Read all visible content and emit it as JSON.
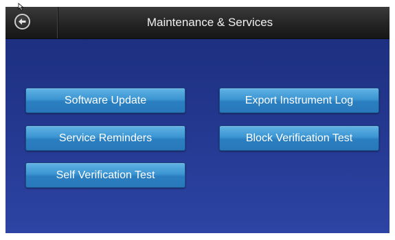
{
  "header": {
    "title": "Maintenance & Services",
    "back_icon": "back-arrow-icon"
  },
  "buttons": {
    "software_update": "Software Update",
    "service_reminders": "Service Reminders",
    "self_verification_test": "Self Verification Test",
    "export_instrument_log": "Export Instrument Log",
    "block_verification_test": "Block Verification Test"
  },
  "colors": {
    "background": "#22368c",
    "titlebar": "#242424",
    "button": "#3c95d2"
  }
}
